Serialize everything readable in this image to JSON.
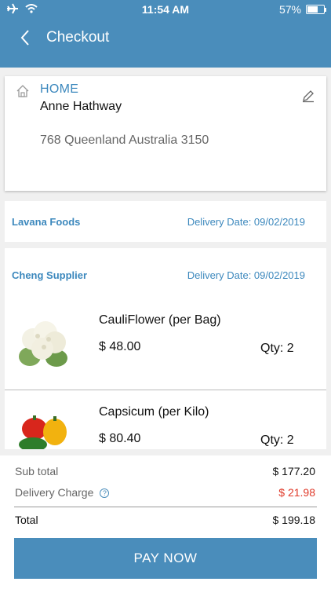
{
  "status_bar": {
    "time": "11:54 AM",
    "battery": "57%",
    "battery_level": 0.57
  },
  "header": {
    "title": "Checkout"
  },
  "address": {
    "type": "HOME",
    "name": "Anne Hathway",
    "line": "768 Queenland Australia 3150"
  },
  "suppliers": [
    {
      "name": "Lavana Foods",
      "delivery": "Delivery Date: 09/02/2019"
    },
    {
      "name": "Cheng Supplier",
      "delivery": "Delivery Date: 09/02/2019"
    }
  ],
  "products": [
    {
      "name": "CauliFlower (per Bag)",
      "price": "$ 48.00",
      "qty": "Qty: 2"
    },
    {
      "name": "Capsicum (per Kilo)",
      "price": "$ 80.40",
      "qty": "Qty: 2"
    }
  ],
  "summary": {
    "subtotal_label": "Sub total",
    "subtotal": "$ 177.20",
    "delivery_label": "Delivery Charge",
    "delivery": "$ 21.98",
    "total_label": "Total",
    "total": "$ 199.18",
    "help_glyph": "?"
  },
  "pay_button": "PAY NOW",
  "colors": {
    "accent": "#4a8dbb",
    "price_red": "#e03a2a"
  }
}
